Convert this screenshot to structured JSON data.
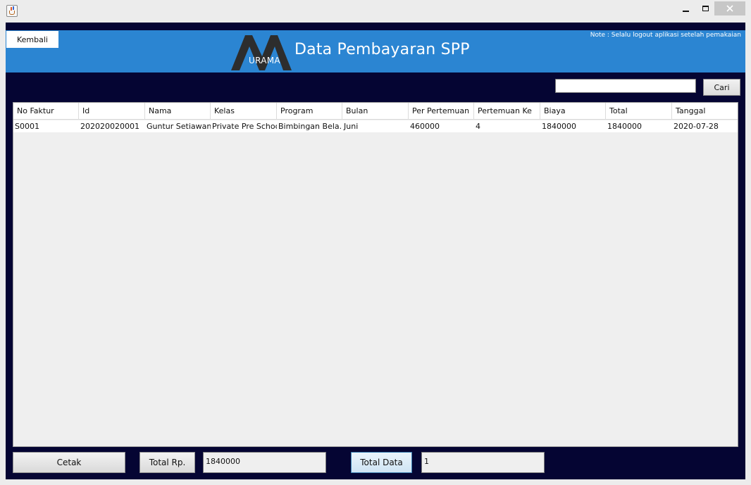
{
  "window": {
    "title": ""
  },
  "header": {
    "back_label": "Kembali",
    "logo_text": "URAMA",
    "title": "Data Pembayaran SPP",
    "note": "Note : Selalu logout aplikasi setelah pemakaian",
    "background_color": "#2b85d2"
  },
  "search": {
    "value": "",
    "button_label": "Cari"
  },
  "table": {
    "columns": [
      "No Faktur",
      "Id",
      "Nama",
      "Kelas",
      "Program",
      "Bulan",
      "Per Pertemuan",
      "Pertemuan Ke",
      "Biaya",
      "Total",
      "Tanggal"
    ],
    "rows": [
      [
        "S0001",
        "202020020001",
        "Guntur Setiawan",
        "Private Pre School",
        "Bimbingan Bela...",
        "Juni",
        "460000",
        "4",
        "1840000",
        "1840000",
        "2020-07-28"
      ]
    ]
  },
  "footer": {
    "print_label": "Cetak",
    "total_rp_label": "Total Rp.",
    "total_rp_value": "1840000",
    "total_data_label": "Total Data",
    "total_data_value": "1"
  },
  "colors": {
    "frame_background": "#050533",
    "header_background": "#2b85d2"
  }
}
